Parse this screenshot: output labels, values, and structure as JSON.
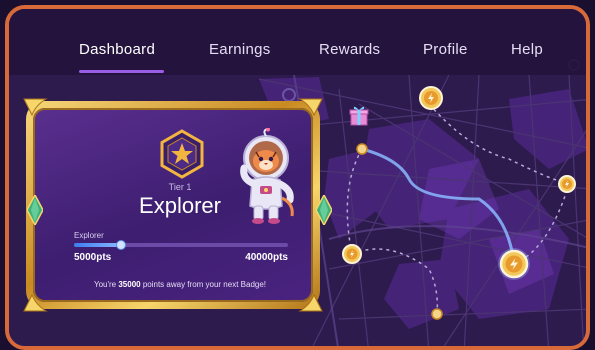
{
  "nav": {
    "items": [
      {
        "label": "Dashboard",
        "active": true
      },
      {
        "label": "Earnings",
        "active": false
      },
      {
        "label": "Rewards",
        "active": false
      },
      {
        "label": "Profile",
        "active": false
      },
      {
        "label": "Help",
        "active": false
      }
    ]
  },
  "badge_card": {
    "tier_label": "Tier 1",
    "tier_name": "Explorer",
    "badge_icon": "star-hexagon-icon",
    "mascot_icon": "astronaut-tiger-mascot",
    "progress": {
      "label": "Explorer",
      "min_label": "5000pts",
      "max_label": "40000pts",
      "current_points": 5000,
      "fill_fraction": 0.22
    },
    "away_prefix": "You're ",
    "away_points": "35000",
    "away_suffix": " points away from your next Badge!"
  },
  "map": {
    "markers": [
      "bolt-coin-icon",
      "bolt-coin-icon",
      "bolt-coin-icon",
      "bolt-coin-icon",
      "bolt-coin-icon",
      "gift-icon"
    ]
  },
  "colors": {
    "frame": "#d86a3a",
    "accent": "#9b5de5",
    "gold": "#e2a93a",
    "card_bg": "#4a2380",
    "progress": "#3d7df0"
  }
}
